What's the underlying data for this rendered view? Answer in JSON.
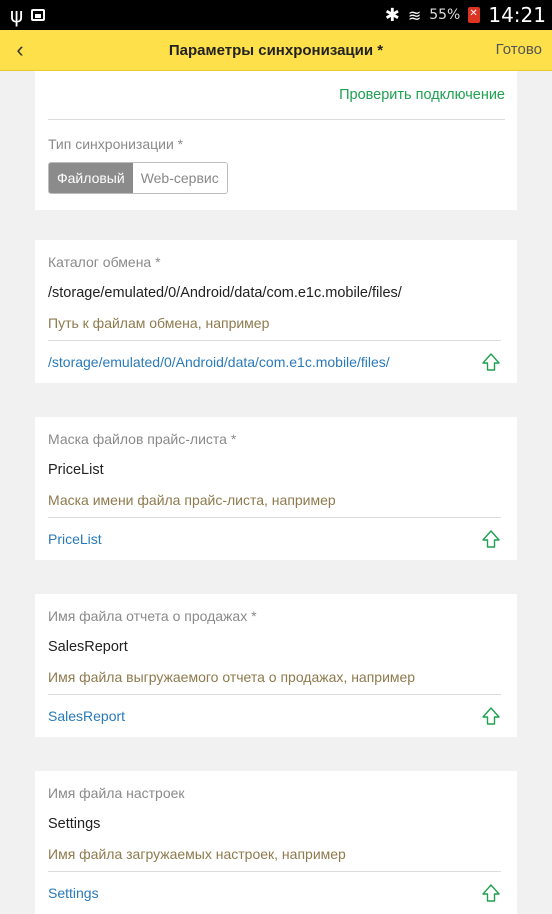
{
  "status_bar": {
    "battery": "55%",
    "time": "14:21"
  },
  "header": {
    "back_icon": "chevron-left-icon",
    "title": "Параметры синхронизации *",
    "done": "Готово"
  },
  "sync": {
    "check_connection": "Проверить подключение",
    "type_label": "Тип синхронизации *",
    "options": [
      "Файловый",
      "Web-сервис"
    ],
    "selected": "Файловый"
  },
  "fields": [
    {
      "label": "Каталог обмена *",
      "value": "/storage/emulated/0/Android/data/com.e1c.mobile/files/",
      "hint": "Путь к файлам обмена, например",
      "example": "/storage/emulated/0/Android/data/com.e1c.mobile/files/"
    },
    {
      "label": "Маска файлов прайс-листа *",
      "value": "PriceList",
      "hint": "Маска имени файла прайс-листа, например",
      "example": "PriceList"
    },
    {
      "label": "Имя файла отчета о продажах *",
      "value": "SalesReport",
      "hint": "Имя файла выгружаемого отчета о продажах, например",
      "example": "SalesReport"
    },
    {
      "label": "Имя файла настроек",
      "value": "Settings",
      "hint": "Имя файла загружаемых настроек, например",
      "example": "Settings"
    }
  ],
  "colors": {
    "header_bg": "#fee04a",
    "link_green": "#1ea151",
    "link_blue": "#2a7ab8",
    "hint_brown": "#8e7a4e"
  }
}
